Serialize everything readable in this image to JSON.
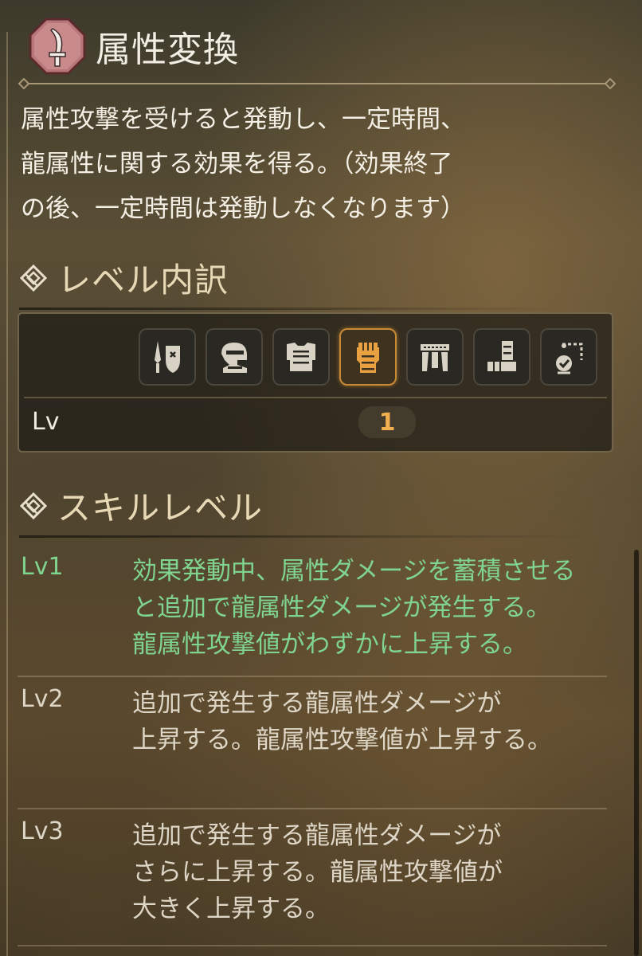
{
  "skill": {
    "icon": "sword-badge-icon",
    "title": "属性変換",
    "description": [
      "属性攻撃を受けると発動し、一定時間、",
      "龍属性に関する効果を得る。（効果終了",
      "の後、一定時間は発動しなくなります）"
    ]
  },
  "breakdown": {
    "title": "レベル内訳",
    "icon": "section-diamond-icon",
    "slots": [
      {
        "icon": "weapon-icon",
        "active": false
      },
      {
        "icon": "helm-icon",
        "active": false
      },
      {
        "icon": "chest-armor-icon",
        "active": false
      },
      {
        "icon": "gauntlet-icon",
        "active": true
      },
      {
        "icon": "waist-armor-icon",
        "active": false
      },
      {
        "icon": "leg-armor-icon",
        "active": false
      },
      {
        "icon": "talisman-icon",
        "active": false
      }
    ],
    "lv_label": "Lv",
    "lv_value": "1"
  },
  "skill_levels": {
    "title": "スキルレベル",
    "icon": "section-diamond-icon",
    "levels": [
      {
        "name": "Lv1",
        "current": true,
        "lines": [
          "効果発動中、属性ダメージを蓄積させる",
          "と追加で龍属性ダメージが発生する。",
          "龍属性攻撃値がわずかに上昇する。"
        ]
      },
      {
        "name": "Lv2",
        "current": false,
        "lines": [
          "追加で発生する龍属性ダメージが",
          "上昇する。龍属性攻撃値が上昇する。"
        ]
      },
      {
        "name": "Lv3",
        "current": false,
        "lines": [
          "追加で発生する龍属性ダメージが",
          "さらに上昇する。龍属性攻撃値が",
          "大きく上昇する。"
        ]
      }
    ]
  },
  "colors": {
    "current_level": "#7fd490",
    "active_slot": "#c68a35",
    "lv_value": "#f0b050"
  }
}
